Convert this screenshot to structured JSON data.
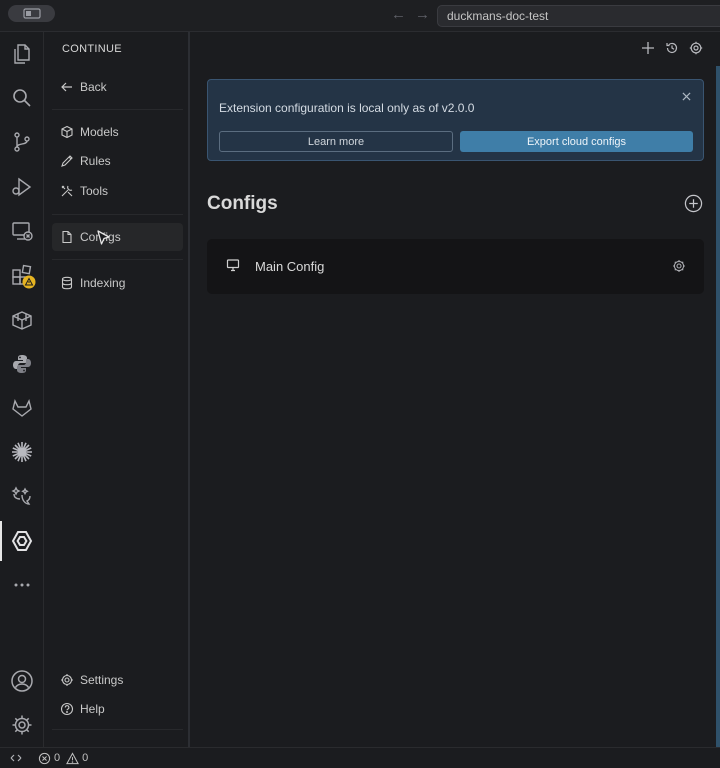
{
  "window": {
    "search_text": "duckmans-doc-test",
    "nav_back": "←",
    "nav_forward": "→"
  },
  "activity_bar": {
    "items": [
      {
        "icon": "files-icon"
      },
      {
        "icon": "search-icon"
      },
      {
        "icon": "source-control-icon"
      },
      {
        "icon": "run-debug-icon"
      },
      {
        "icon": "remote-explorer-icon"
      },
      {
        "icon": "extensions-icon",
        "badge": "warning"
      },
      {
        "icon": "containers-icon"
      },
      {
        "icon": "python-icon"
      },
      {
        "icon": "gitlab-icon"
      },
      {
        "icon": "claude-sparkle-icon"
      },
      {
        "icon": "ai-chat-icon"
      },
      {
        "icon": "continue-icon",
        "active": true
      },
      {
        "icon": "more-icon"
      }
    ],
    "bottom": [
      {
        "icon": "account-icon"
      },
      {
        "icon": "manage-gear-icon"
      }
    ]
  },
  "sidebar": {
    "title": "CONTINUE",
    "back_label": "Back",
    "items_group1": [
      {
        "label": "Models",
        "icon": "cube-icon"
      },
      {
        "label": "Rules",
        "icon": "pencil-icon"
      },
      {
        "label": "Tools",
        "icon": "tools-icon"
      }
    ],
    "configs_label": "Configs",
    "indexing_label": "Indexing",
    "settings_label": "Settings",
    "help_label": "Help"
  },
  "banner": {
    "message": "Extension configuration is local only as of v2.0.0",
    "learn_more": "Learn more",
    "export": "Export cloud configs"
  },
  "configs": {
    "title": "Configs",
    "items": [
      {
        "name": "Main Config"
      }
    ]
  },
  "status": {
    "errors": "0",
    "warnings": "0"
  },
  "colors": {
    "accent": "#3f7ea8",
    "banner_bg": "#243446",
    "warning": "#e6b422"
  }
}
